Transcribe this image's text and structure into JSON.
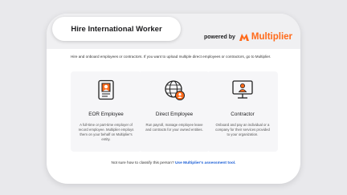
{
  "dialog": {
    "title": "Hire International Worker",
    "powered_by": "powered by",
    "brand": "Multiplier",
    "brand_color": "#ff6a1a",
    "intro": "Hire and onboard employees or contractors. If you want to upload multiple direct employees or contractors, go to Multiplier."
  },
  "cards": [
    {
      "icon": "employee-badge-icon",
      "title": "EOR Employee",
      "desc": "A full-time or part-time employer of record employee. Multiplier employs them on your behalf on Multiplier's entity."
    },
    {
      "icon": "globe-person-icon",
      "title": "Direct Employee",
      "desc": "Run payroll, manage employee leave and contracts for your owned entities."
    },
    {
      "icon": "monitor-person-icon",
      "title": "Contractor",
      "desc": "Onboard and pay an individual or a company for their services provided to your organization."
    }
  ],
  "footer": {
    "text": "Not sure how to classify this person?",
    "link": "Use Multiplier's assessment tool."
  }
}
